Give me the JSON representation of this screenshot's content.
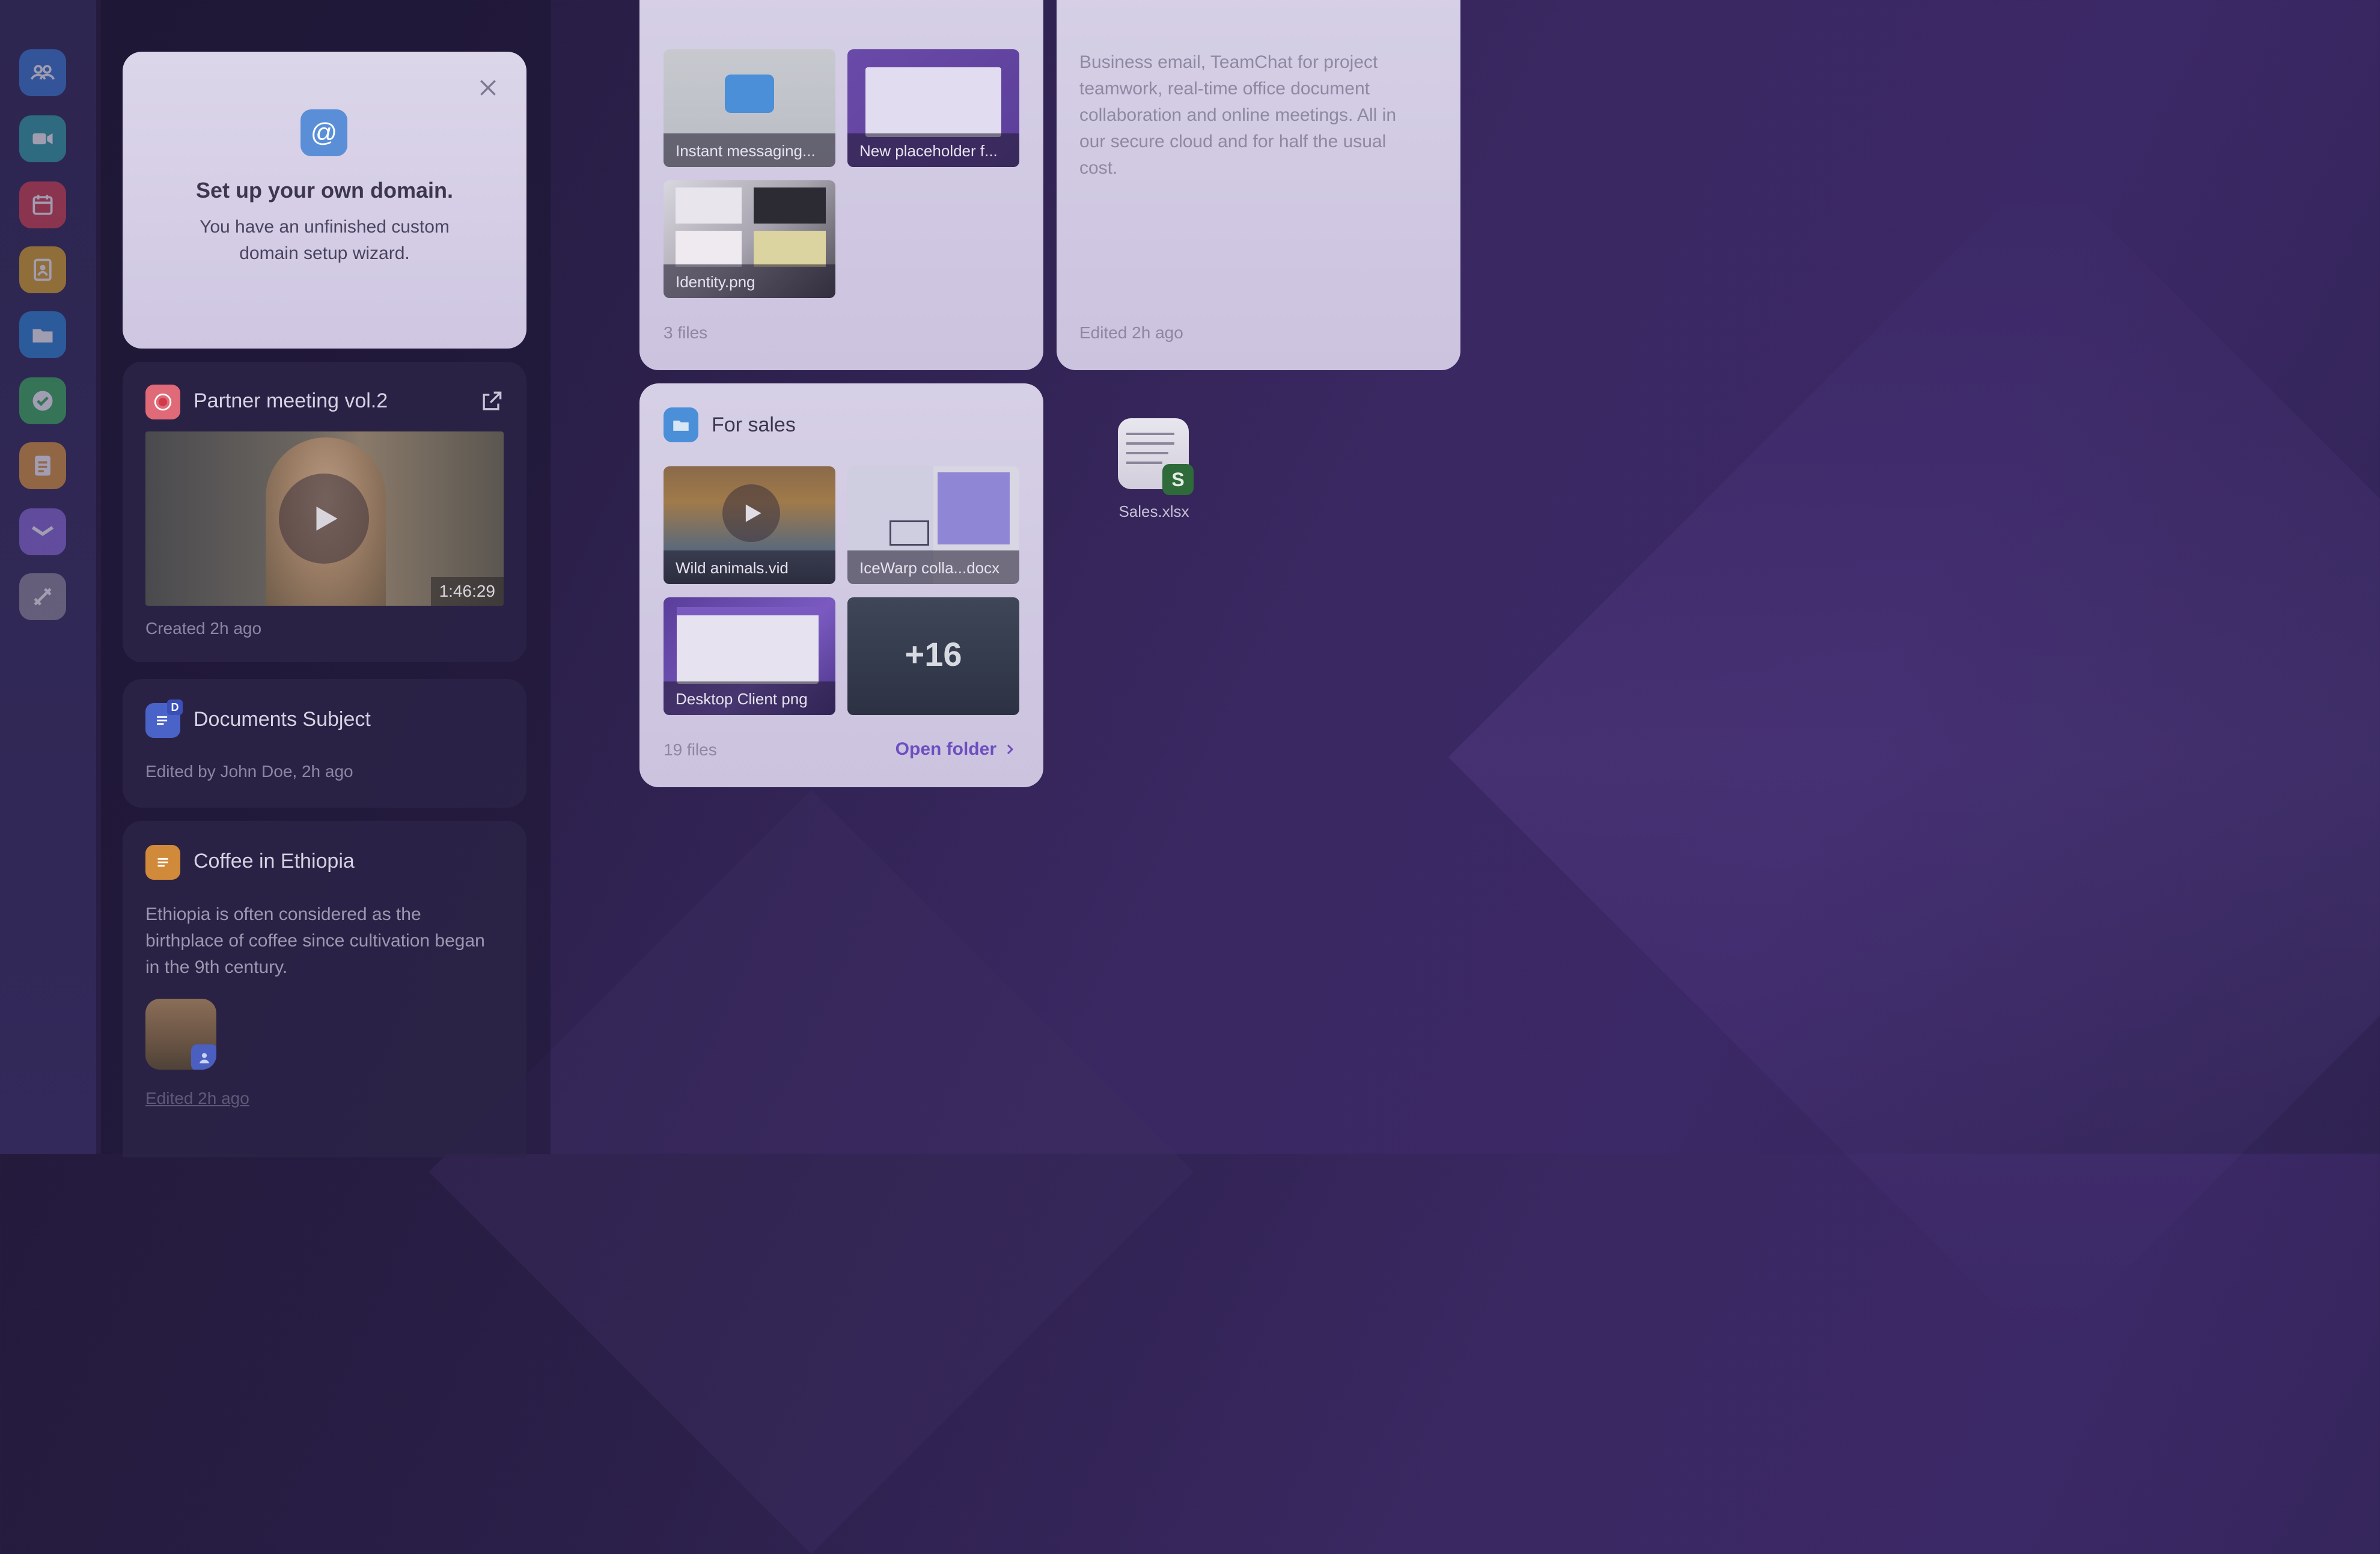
{
  "domain_card": {
    "title": "Set up your own domain.",
    "body": "You have an unfinished custom domain setup wizard.",
    "icon": "at-icon",
    "close_icon": "close-icon"
  },
  "meeting_card": {
    "title": "Partner meeting vol.2",
    "duration": "1:46:29",
    "meta": "Created 2h ago",
    "icon": "record-icon",
    "open_icon": "external-link-icon"
  },
  "documents_card": {
    "title": "Documents Subject",
    "meta": "Edited by John Doe, 2h ago",
    "badge": "D"
  },
  "coffee_card": {
    "title": "Coffee in Ethiopia",
    "body": "Ethiopia is often considered as the birthplace of coffee since cultivation began in the 9th century.",
    "meta": "Edited 2h ago"
  },
  "top_folder": {
    "files": [
      {
        "label": "Instant messaging..."
      },
      {
        "label": "New placeholder f..."
      },
      {
        "label": "Identity.png"
      }
    ],
    "count": "3 files"
  },
  "note_card": {
    "body": "Business email, TeamChat for project teamwork, real-time office document collaboration and online meetings. All in our secure cloud and for half the usual cost.",
    "meta": "Edited 2h ago"
  },
  "sales_folder": {
    "title": "For sales",
    "files": [
      {
        "label": "Wild animals.vid"
      },
      {
        "label": "IceWarp colla...docx"
      },
      {
        "label": "Desktop Client png"
      }
    ],
    "more": "+16",
    "count": "19 files",
    "open_label": "Open folder"
  },
  "desktop_file": {
    "label": "Sales.xlsx",
    "badge": "S"
  },
  "rail": {
    "items": [
      "contacts-icon",
      "video-icon",
      "calendar-icon",
      "addressbook-icon",
      "files-icon",
      "tasks-icon",
      "notes-icon",
      "mail-icon",
      "tools-icon"
    ]
  },
  "colors": {
    "accent": "#7a5cc8",
    "link": "#6d4fc0"
  }
}
